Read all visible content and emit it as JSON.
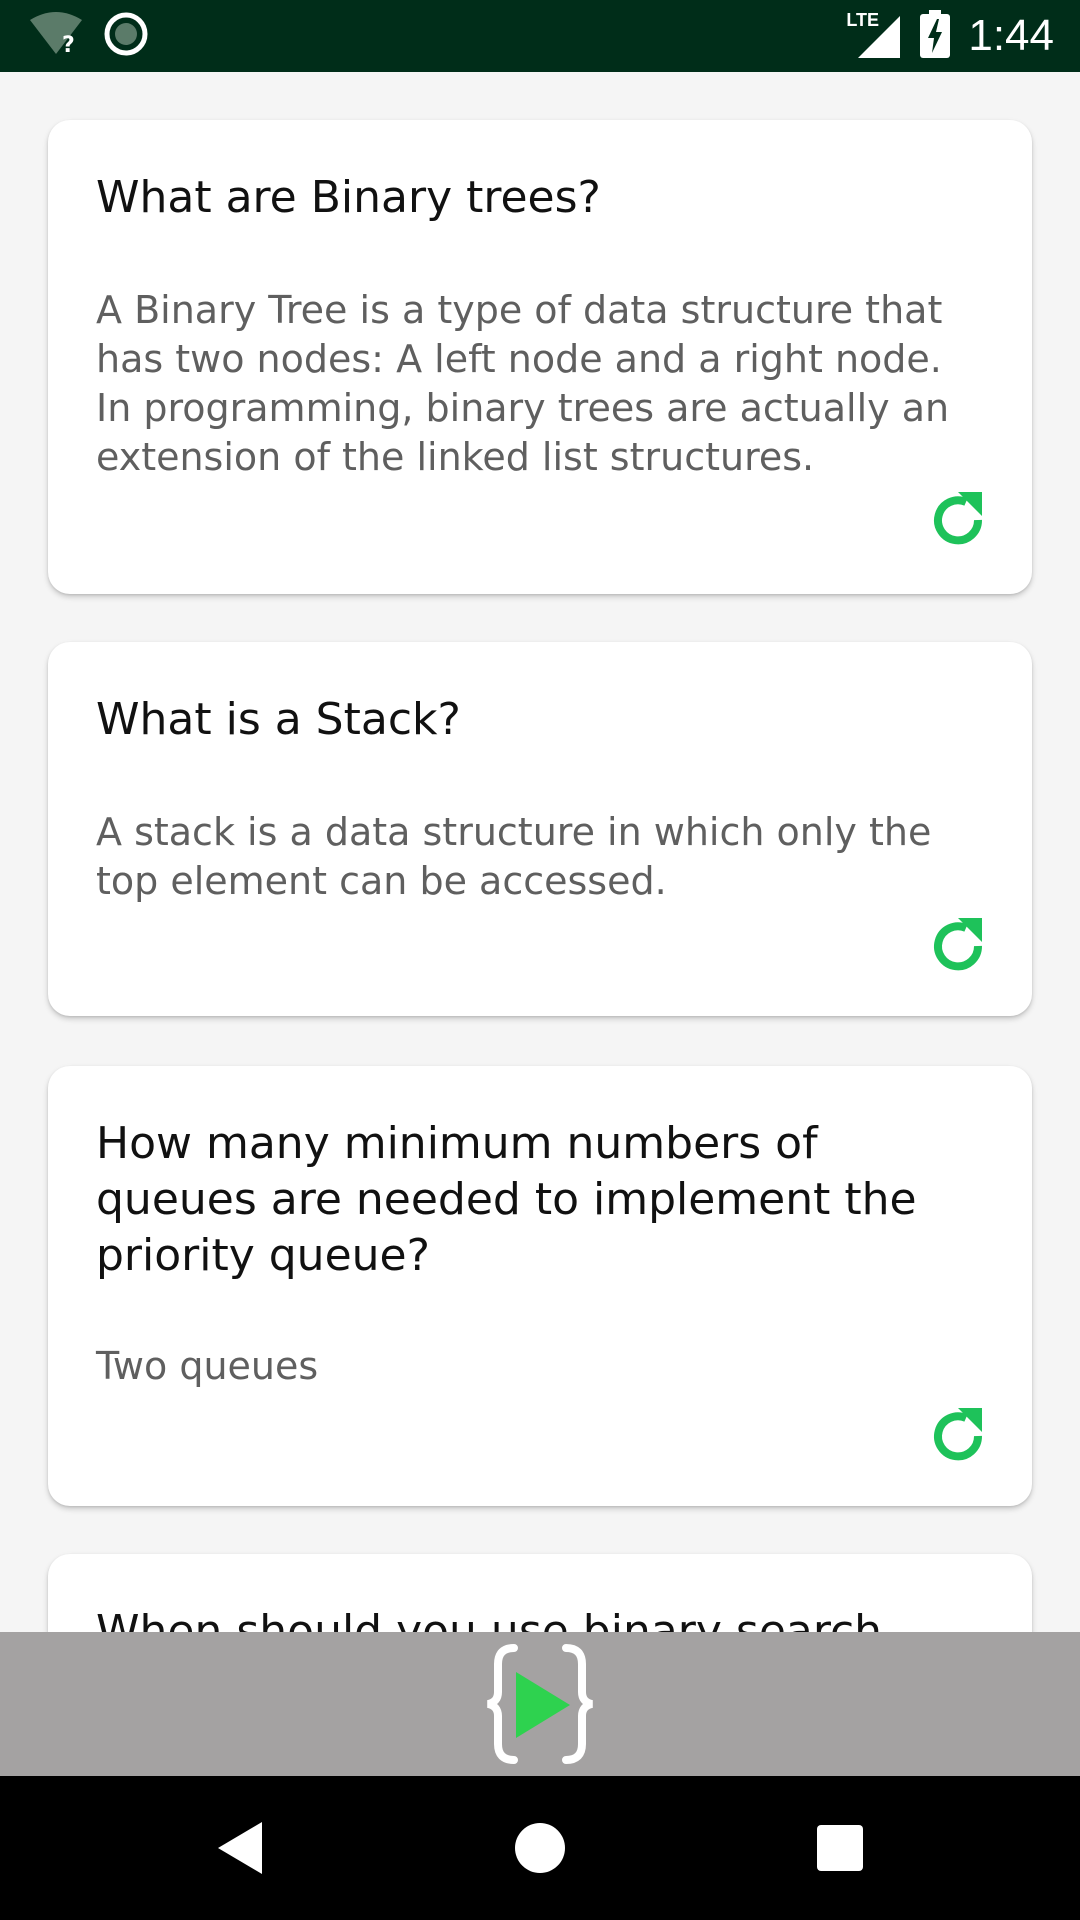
{
  "status_bar": {
    "time": "1:44",
    "network_label": "LTE",
    "icons": [
      "wifi-unknown-icon",
      "sync-circle-icon",
      "cell-signal-icon",
      "battery-charging-icon"
    ]
  },
  "cards": [
    {
      "question": "What are Binary trees?",
      "answer": "A Binary Tree is a type of data structure that has two nodes: A left node and a right node. In programming, binary trees are actually an extension of the linked list structures.",
      "icon": "refresh-icon"
    },
    {
      "question": "What is a Stack?",
      "answer": "A stack is a data structure in which only the top element can be accessed.",
      "icon": "refresh-icon"
    },
    {
      "question": "How many minimum numbers of queues are needed to implement the priority queue?",
      "answer": "Two queues",
      "icon": "refresh-icon"
    },
    {
      "question": "When should you use binary search",
      "answer": "",
      "icon": ""
    }
  ],
  "ad_bar": {
    "icon": "app-logo-icon"
  },
  "nav_bar": {
    "icons": [
      "back-icon",
      "home-icon",
      "recents-icon"
    ]
  },
  "colors": {
    "status_bar": "#002d19",
    "accent_green": "#1ec25a",
    "ad_bar": "#a4a2a2",
    "background": "#f5f5f5"
  }
}
